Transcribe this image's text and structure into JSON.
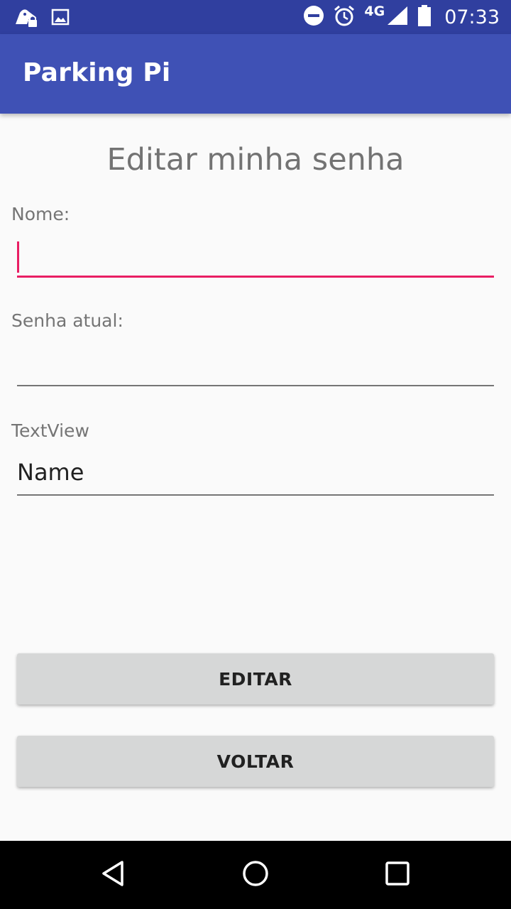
{
  "status_bar": {
    "time": "07:33",
    "network": "4G",
    "icons": [
      "ghost-app-icon",
      "image-icon",
      "do-not-disturb-icon",
      "alarm-icon",
      "signal-icon",
      "battery-icon"
    ]
  },
  "app_bar": {
    "title": "Parking Pi"
  },
  "form": {
    "heading": "Editar minha senha",
    "name_label": "Nome:",
    "name_value": "",
    "current_password_label": "Senha atual:",
    "current_password_value": "",
    "textview_label": "TextView",
    "name_field_value": "Name"
  },
  "buttons": {
    "edit_label": "EDITAR",
    "back_label": "VOLTAR"
  },
  "nav_bar": {
    "icons": [
      "back-icon",
      "home-icon",
      "recents-icon"
    ]
  },
  "colors": {
    "status_bar": "#303f9f",
    "app_bar": "#3f51b5",
    "accent": "#e91e63",
    "button": "#d6d7d7",
    "nav_bar": "#000000"
  }
}
